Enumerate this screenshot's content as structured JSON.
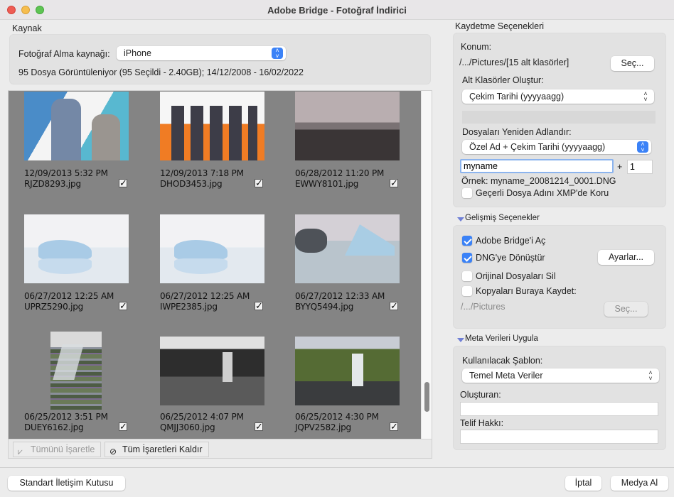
{
  "window": {
    "title": "Adobe Bridge - Fotoğraf İndirici"
  },
  "source": {
    "section_label": "Kaynak",
    "source_label": "Fotoğraf Alma kaynağı:",
    "source_value": "iPhone",
    "summary": "95 Dosya Görüntüleniyor (95 Seçildi - 2.40GB); 14/12/2008 - 16/02/2022"
  },
  "gallery": {
    "items": [
      {
        "date": "12/09/2013 5:32 PM",
        "name": "RJZD8293.jpg",
        "checked": true,
        "thumb": "portrait-duo"
      },
      {
        "date": "12/09/2013 7:18 PM",
        "name": "DHOD3453.jpg",
        "checked": true,
        "thumb": "band-orange"
      },
      {
        "date": "06/28/2012 11:20 PM",
        "name": "EWWY8101.jpg",
        "checked": true,
        "thumb": "bw-landscape"
      },
      {
        "date": "06/27/2012 12:25 AM",
        "name": "UPRZ5290.jpg",
        "checked": true,
        "thumb": "iceberg-light"
      },
      {
        "date": "06/27/2012 12:25 AM",
        "name": "IWPE2385.jpg",
        "checked": true,
        "thumb": "iceberg-light"
      },
      {
        "date": "06/27/2012 12:33 AM",
        "name": "BYYQ5494.jpg",
        "checked": true,
        "thumb": "iceberg-dark"
      },
      {
        "date": "06/25/2012 3:51 PM",
        "name": "DUEY6162.jpg",
        "checked": true,
        "thumb": "waterfall-glitch"
      },
      {
        "date": "06/25/2012 4:07 PM",
        "name": "QMJJ3060.jpg",
        "checked": true,
        "thumb": "waterfall-bw"
      },
      {
        "date": "06/25/2012 4:30 PM",
        "name": "JQPV2582.jpg",
        "checked": true,
        "thumb": "waterfall-green"
      }
    ],
    "check_glyph": "✓",
    "mark_all_label": "Tümünü İşaretle",
    "unmark_all_label": "Tüm İşaretleri Kaldır",
    "scroll_position": 0.92
  },
  "save_options": {
    "section_label": "Kaydetme Seçenekleri",
    "location_label": "Konum:",
    "location_value": "/.../Pictures/[15 alt klasörler]",
    "choose_label": "Seç...",
    "subfolders_label": "Alt Klasörler Oluştur:",
    "subfolders_value": "Çekim Tarihi (yyyyaagg)",
    "rename_label": "Dosyaları Yeniden Adlandır:",
    "rename_value": "Özel Ad + Çekim Tarihi (yyyyaagg)",
    "custom_name": "myname",
    "plus": "+",
    "start_number": "1",
    "example_label": "Örnek:",
    "example_value": "myname_20081214_0001.DNG",
    "preserve_xmp_label": "Geçerli Dosya Adını XMP'de Koru",
    "preserve_xmp_checked": false
  },
  "advanced": {
    "section_label": "Gelişmiş Seçenekler",
    "open_bridge_label": "Adobe Bridge'i Aç",
    "open_bridge_checked": true,
    "convert_dng_label": "DNG'ye Dönüştür",
    "convert_dng_checked": true,
    "settings_label": "Ayarlar...",
    "delete_originals_label": "Orijinal Dosyaları Sil",
    "delete_originals_checked": false,
    "save_copies_label": "Kopyaları Buraya Kaydet:",
    "save_copies_checked": false,
    "copies_path": "/.../Pictures",
    "copies_choose_label": "Seç..."
  },
  "metadata": {
    "section_label": "Meta Verileri Uygula",
    "template_label": "Kullanılacak Şablon:",
    "template_value": "Temel Meta Veriler",
    "creator_label": "Oluşturan:",
    "creator_value": "",
    "copyright_label": "Telif Hakkı:",
    "copyright_value": ""
  },
  "footer": {
    "standard_dialog_label": "Standart İletişim Kutusu",
    "cancel_label": "İptal",
    "get_media_label": "Medya Al"
  },
  "colors": {
    "accent": "#3b82f7",
    "gallery_bg": "#848484"
  }
}
